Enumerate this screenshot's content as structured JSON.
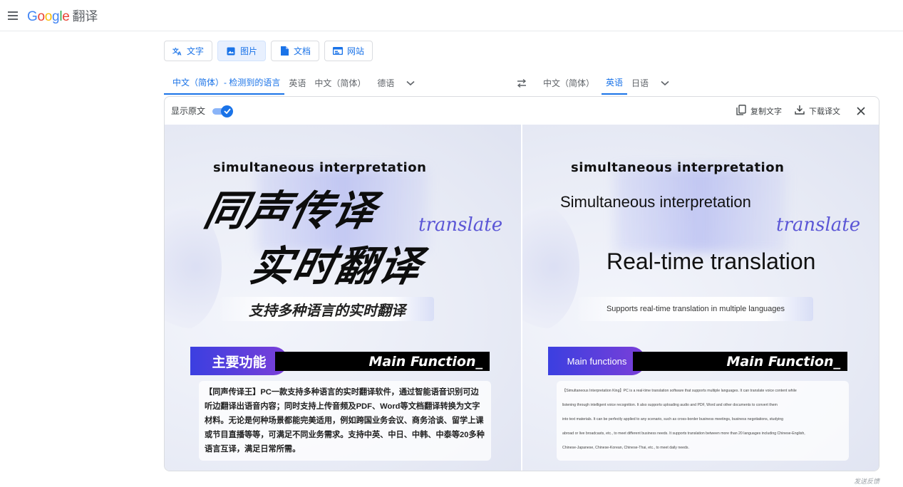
{
  "header": {
    "logo": [
      "G",
      "o",
      "o",
      "g",
      "l",
      "e"
    ],
    "product": "翻译"
  },
  "modes": [
    {
      "label": "文字",
      "icon": "translate-icon"
    },
    {
      "label": "图片",
      "icon": "image-icon"
    },
    {
      "label": "文档",
      "icon": "document-icon"
    },
    {
      "label": "网站",
      "icon": "website-icon"
    }
  ],
  "source_langs": [
    "中文（简体）- 检测到的语言",
    "英语",
    "中文（简体）",
    "德语"
  ],
  "target_langs": [
    "中文（简体）",
    "英语",
    "日语"
  ],
  "toolbar": {
    "show_original": "显示原文",
    "copy_text": "复制文字",
    "download": "下载译文"
  },
  "left_image": {
    "en_title": "simultaneous interpretation",
    "cn_line1": "同声传译",
    "script": "translate",
    "cn_line2": "实时翻译",
    "banner": "支持多种语言的实时翻译",
    "mf_left": "主要功能",
    "mf_right": "Main Function_",
    "body": "【同声传译王】PC一款支持多种语言的实时翻译软件，通过智能语音识别可边听边翻译出语音内容；同时支持上传音频及PDF、Word等文档翻译转换为文字材料。无论是何种场景都能完美适用，例如跨国业务会议、商务洽谈、留学上课或节目直播等等，可满足不同业务需求。支持中英、中日、中韩、中泰等20多种语言互译，满足日常所需。"
  },
  "right_image": {
    "en_title": "simultaneous interpretation",
    "line1": "Simultaneous interpretation",
    "script": "translate",
    "line2": "Real-time translation",
    "banner": "Supports real-time translation in multiple languages",
    "mf_left": "Main functions",
    "mf_right": "Main Function_",
    "body_lines": [
      "【Simultaneous Interpretation King】PC is a real-time translation software that supports multiple languages. It can translate voice content while",
      "listening through intelligent voice recognition. It also supports uploading audio and PDF, Word and other documents to convert them",
      "into text materials. It can be perfectly applied to any scenario, such as cross-border business meetings, business negotiations, studying",
      "abroad or live broadcasts, etc., to meet different business needs. It supports translation between more than 20 languages including Chinese-English,",
      "Chinese-Japanese, Chinese-Korean, Chinese-Thai, etc., to meet daily needs."
    ]
  },
  "feedback": "发送反馈",
  "colors": {
    "accent": "#1a73e8",
    "mf_gradient_start": "#3b3fe0",
    "mf_gradient_end": "#7b3fd8"
  }
}
